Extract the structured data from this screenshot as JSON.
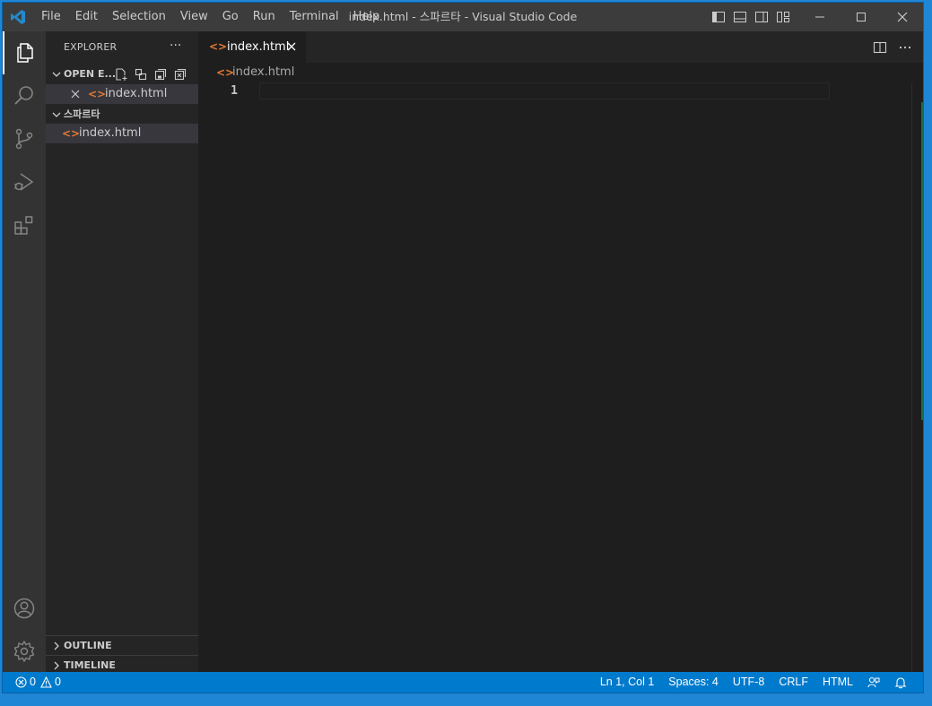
{
  "titlebar": {
    "menu": [
      "File",
      "Edit",
      "Selection",
      "View",
      "Go",
      "Run",
      "Terminal",
      "Help"
    ],
    "title": "index.html - 스파르타 - Visual Studio Code"
  },
  "sidebar": {
    "title": "EXPLORER",
    "more": "···",
    "open_editors": {
      "label": "OPEN E...",
      "items": [
        {
          "name": "index.html"
        }
      ]
    },
    "folder": {
      "label": "스파르타",
      "items": [
        {
          "name": "index.html"
        }
      ]
    },
    "outline_label": "OUTLINE",
    "timeline_label": "TIMELINE"
  },
  "editor": {
    "tab": {
      "label": "index.html"
    },
    "breadcrumb": "index.html",
    "line_numbers": [
      "1"
    ]
  },
  "statusbar": {
    "errors": "0",
    "warnings": "0",
    "position": "Ln 1, Col 1",
    "spaces": "Spaces: 4",
    "encoding": "UTF-8",
    "eol": "CRLF",
    "language": "HTML"
  },
  "colors": {
    "accent": "#007acc",
    "titlebar": "#3c3c3c",
    "activitybar": "#333333",
    "sidebar": "#252526",
    "editor": "#1e1e1e",
    "html_icon": "#e37933"
  }
}
